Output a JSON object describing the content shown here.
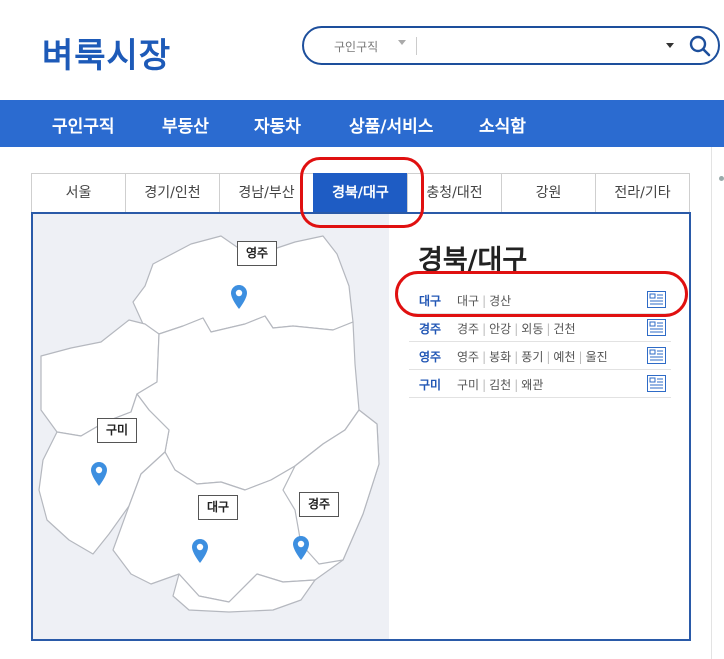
{
  "header": {
    "logo": "벼룩시장",
    "search": {
      "category": "구인구직",
      "value": ""
    }
  },
  "nav": {
    "items": [
      "구인구직",
      "부동산",
      "자동차",
      "상품/서비스",
      "소식함"
    ]
  },
  "tabs": {
    "items": [
      "서울",
      "경기/인천",
      "경남/부산",
      "경북/대구",
      "충청/대전",
      "강원",
      "전라/기타"
    ],
    "active": "경북/대구"
  },
  "region": {
    "title": "경북/대구",
    "rows": [
      {
        "key": "대구",
        "cities": [
          "대구",
          "경산"
        ]
      },
      {
        "key": "경주",
        "cities": [
          "경주",
          "안강",
          "외동",
          "건천"
        ]
      },
      {
        "key": "영주",
        "cities": [
          "영주",
          "봉화",
          "풍기",
          "예천",
          "울진"
        ]
      },
      {
        "key": "구미",
        "cities": [
          "구미",
          "김천",
          "왜관"
        ]
      }
    ]
  },
  "map": {
    "pins": [
      "영주",
      "구미",
      "대구",
      "경주"
    ]
  },
  "colors": {
    "brand": "#1d5ab8",
    "nav": "#2b6bd0",
    "tab_active": "#1e5cc4",
    "pin": "#3d8fe0",
    "annotation": "#e01010"
  }
}
